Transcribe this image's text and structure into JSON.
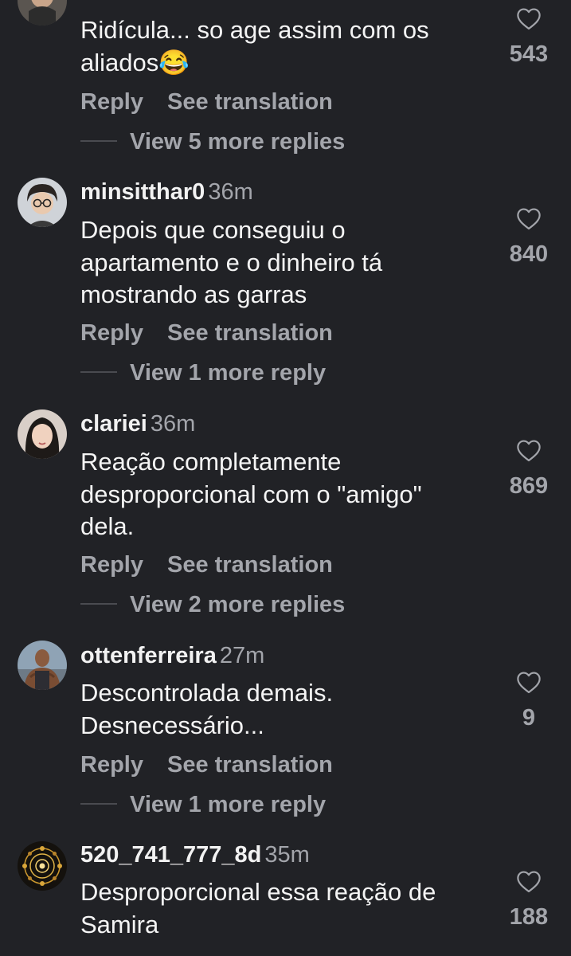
{
  "comments": [
    {
      "username": "",
      "time": "",
      "text": "Ridícula... so age assim com os aliados😂",
      "likes": "543",
      "reply_label": "Reply",
      "translate_label": "See translation",
      "more_replies": "View 5 more replies"
    },
    {
      "username": "minsitthar0",
      "time": "36m",
      "text": "Depois que conseguiu o apartamento e o dinheiro tá mostrando as garras",
      "likes": "840",
      "reply_label": "Reply",
      "translate_label": "See translation",
      "more_replies": "View 1 more reply"
    },
    {
      "username": "clariei",
      "time": "36m",
      "text": "Reação completamente desproporcional com o \"amigo\" dela.",
      "likes": "869",
      "reply_label": "Reply",
      "translate_label": "See translation",
      "more_replies": "View 2 more replies"
    },
    {
      "username": "ottenferreira",
      "time": "27m",
      "text": "Descontrolada demais. Desnecessário...",
      "likes": "9",
      "reply_label": "Reply",
      "translate_label": "See translation",
      "more_replies": "View 1 more reply"
    },
    {
      "username": "520_741_777_8d",
      "time": "35m",
      "text": "Desproporcional essa reação de Samira",
      "likes": "188"
    }
  ],
  "icons": {
    "like": "heart-outline-icon"
  },
  "colors": {
    "background": "#212226",
    "primary_text": "#f2f2f2",
    "secondary_text": "#a3a5ab"
  }
}
